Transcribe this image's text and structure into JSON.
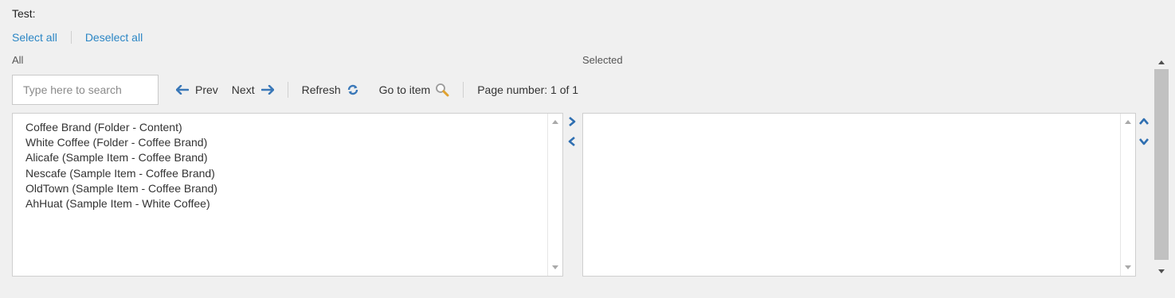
{
  "field": {
    "label": "Test:"
  },
  "selection_links": {
    "select_all": "Select all",
    "deselect_all": "Deselect all"
  },
  "columns": {
    "all_label": "All",
    "selected_label": "Selected"
  },
  "search": {
    "placeholder": "Type here to search",
    "value": ""
  },
  "toolbar": {
    "prev": "Prev",
    "next": "Next",
    "refresh": "Refresh",
    "goto": "Go to item",
    "page_number": "Page number: 1 of 1"
  },
  "all_items": [
    "Coffee Brand (Folder - Content)",
    "White Coffee (Folder - Coffee Brand)",
    "Alicafe (Sample Item - Coffee Brand)",
    "Nescafe (Sample Item - Coffee Brand)",
    "OldTown (Sample Item - Coffee Brand)",
    "AhHuat (Sample Item - White Coffee)"
  ],
  "selected_items": [],
  "icons": {
    "prev": "arrow-left-icon",
    "next": "arrow-right-icon",
    "refresh": "refresh-icon",
    "goto": "magnifier-icon",
    "add": "chevron-right-icon",
    "remove": "chevron-left-icon",
    "move_up": "chevron-up-icon",
    "move_down": "chevron-down-icon"
  },
  "colors": {
    "link": "#2b86c5",
    "icon_blue": "#3a78b8",
    "background": "#f0f0f0"
  }
}
